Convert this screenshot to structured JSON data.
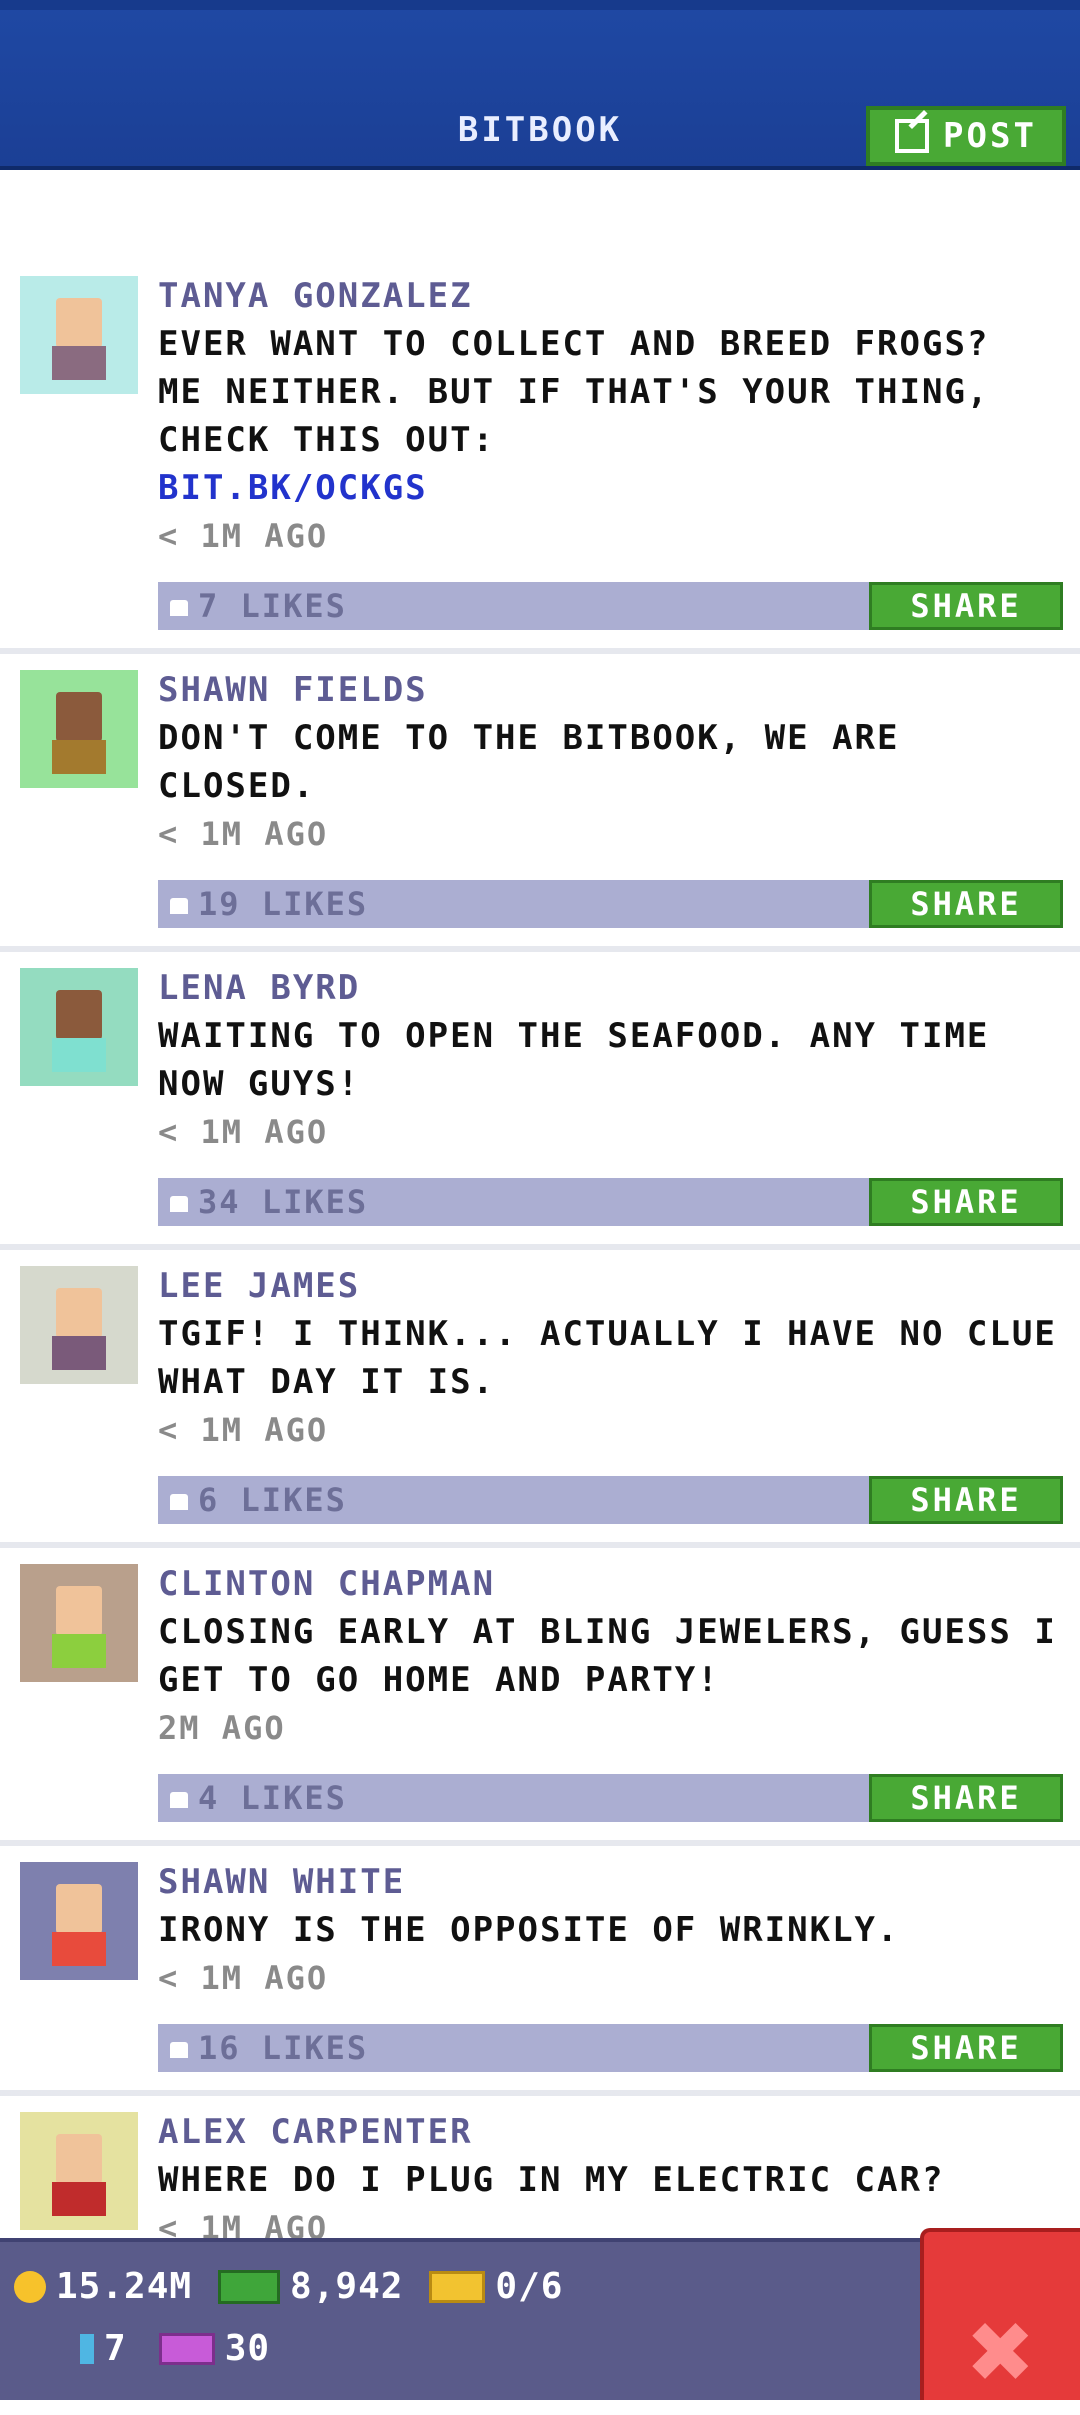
{
  "header": {
    "title": "BITBOOK",
    "post_label": "POST"
  },
  "posts": [
    {
      "author": "TANYA GONZALEZ",
      "message": "EVER WANT TO COLLECT AND BREED FROGS?\nME NEITHER. BUT IF THAT'S YOUR THING,\nCHECK THIS OUT:",
      "link": "BIT.BK/OCKGS",
      "time": "< 1M AGO",
      "likes": "7 LIKES",
      "share_label": "SHARE",
      "avatar_bg": "#b9ebe8",
      "skin": "#f0c39a",
      "shirt": "#8a6b80"
    },
    {
      "author": "SHAWN FIELDS",
      "message": "DON'T COME TO THE BITBOOK, WE ARE\nCLOSED.",
      "link": "",
      "time": "< 1M AGO",
      "likes": "19 LIKES",
      "share_label": "SHARE",
      "avatar_bg": "#97e39a",
      "skin": "#8b5a3c",
      "shirt": "#a37a2e"
    },
    {
      "author": "LENA BYRD",
      "message": "WAITING TO OPEN THE SEAFOOD. ANY TIME\nNOW GUYS!",
      "link": "",
      "time": "< 1M AGO",
      "likes": "34 LIKES",
      "share_label": "SHARE",
      "avatar_bg": "#94dcc0",
      "skin": "#8b5a3c",
      "shirt": "#7fe0d0"
    },
    {
      "author": "LEE JAMES",
      "message": "TGIF! I THINK... ACTUALLY I HAVE NO CLUE\nWHAT DAY IT IS.",
      "link": "",
      "time": "< 1M AGO",
      "likes": "6 LIKES",
      "share_label": "SHARE",
      "avatar_bg": "#d6d9cd",
      "skin": "#f0c39a",
      "shirt": "#7a5a7a"
    },
    {
      "author": "CLINTON CHAPMAN",
      "message": "CLOSING EARLY AT BLING JEWELERS, GUESS I\nGET TO GO HOME AND PARTY!",
      "link": "",
      "time": "2M AGO",
      "likes": "4 LIKES",
      "share_label": "SHARE",
      "avatar_bg": "#b9a08c",
      "skin": "#f0c39a",
      "shirt": "#8ccf3e"
    },
    {
      "author": "SHAWN WHITE",
      "message": "IRONY IS THE OPPOSITE OF WRINKLY.",
      "link": "",
      "time": "< 1M AGO",
      "likes": "16 LIKES",
      "share_label": "SHARE",
      "avatar_bg": "#7e80ae",
      "skin": "#f0c39a",
      "shirt": "#e84b3c"
    },
    {
      "author": "ALEX CARPENTER",
      "message": "WHERE DO I PLUG IN MY ELECTRIC CAR?",
      "link": "",
      "time": "< 1M AGO",
      "likes": "",
      "share_label": "",
      "avatar_bg": "#e5e2a0",
      "skin": "#f0c39a",
      "shirt": "#c02c2c"
    }
  ],
  "hud": {
    "coins": "15.24M",
    "bux": "8,942",
    "tickets": "0/6",
    "phones": "7",
    "vip": "30"
  },
  "icons": {
    "post": "edit-icon",
    "like": "thumbs-up-icon",
    "close": "close-icon",
    "coin": "coin-icon",
    "bux": "bux-icon",
    "ticket": "ticket-icon",
    "phone": "phone-icon",
    "vip": "vip-icon"
  }
}
